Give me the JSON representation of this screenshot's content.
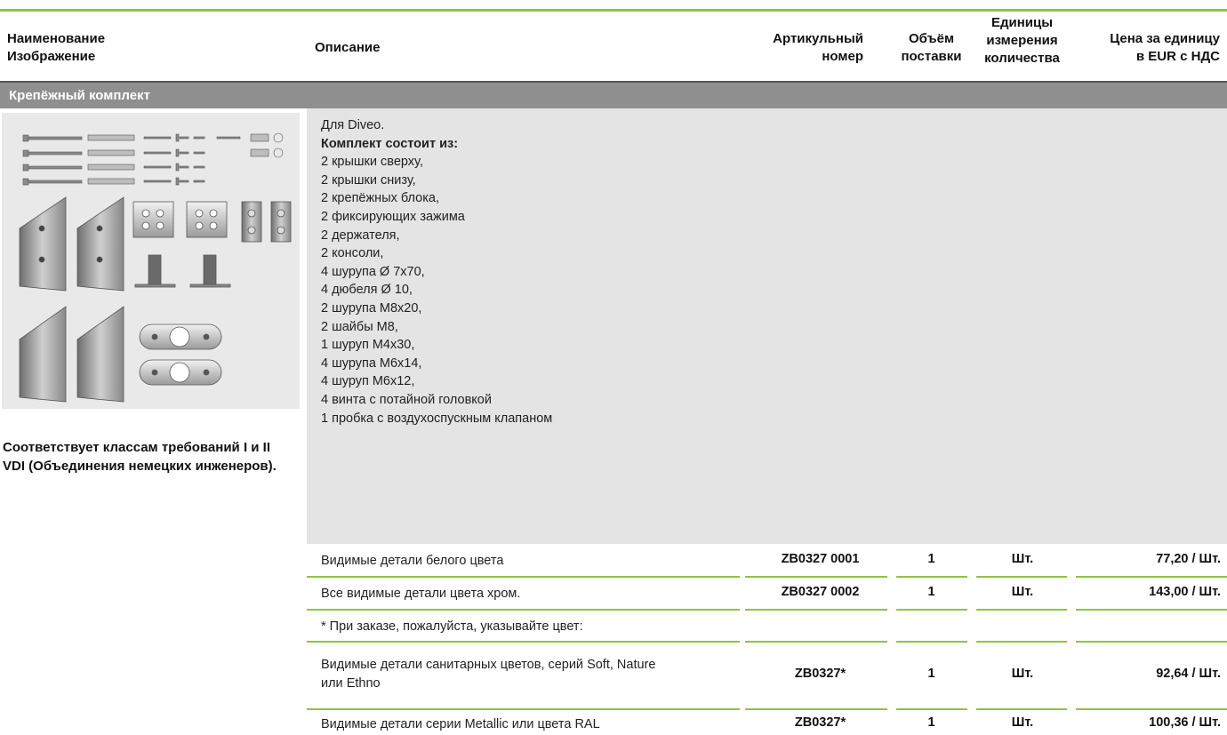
{
  "header": {
    "col1": [
      "Наименование",
      "Изображение"
    ],
    "col2": "Описание",
    "col3": [
      "Артикульный",
      "номер"
    ],
    "col4": [
      "Объём",
      "поставки"
    ],
    "col5": [
      "Единицы",
      "измерения",
      "количества"
    ],
    "col6": [
      "Цена за единицу",
      "в EUR с НДС"
    ]
  },
  "section": {
    "title": "Крепёжный комплект"
  },
  "left_note": "Соответствует классам требований I и II VDI (Объединения немецких инженеров).",
  "description": {
    "intro": "Для Diveo.",
    "heading": "Комплект состоит из:",
    "items": [
      "2 крышки сверху,",
      "2 крышки снизу,",
      "2 крепёжных блока,",
      "2 фиксирующих зажима",
      "2 держателя,",
      "2 консоли,",
      "4 шурупа Ø 7х70,",
      "4 дюбеля Ø 10,",
      "2 шурупа M8x20,",
      "2 шайбы M8,",
      "1 шуруп M4x30,",
      "4 шурупа M6x14,",
      "4 шуруп M6x12,",
      "4 винта с потайной головкой",
      "1 пробка с воздухоспускным клапаном"
    ]
  },
  "rows": [
    {
      "desc": "Видимые детали белого цвета",
      "article": "ZB0327 0001",
      "qty": "1",
      "unit": "Шт.",
      "price": "77,20 / Шт."
    },
    {
      "desc": "Все видимые детали цвета хром.",
      "article": "ZB0327 0002",
      "qty": "1",
      "unit": "Шт.",
      "price": "143,00 / Шт."
    },
    {
      "desc": "* При заказе, пожалуйста, указывайте цвет:",
      "article": "",
      "qty": "",
      "unit": "",
      "price": ""
    },
    {
      "desc_lines": [
        "Видимые детали санитарных цветов, серий Soft, Nature",
        "или Ethno"
      ],
      "article": "ZB0327*",
      "qty": "1",
      "unit": "Шт.",
      "price": "92,64 / Шт."
    },
    {
      "desc": "Видимые детали серии Metallic или цвета RAL",
      "article": "ZB0327*",
      "qty": "1",
      "unit": "Шт.",
      "price": "100,36 / Шт."
    }
  ]
}
